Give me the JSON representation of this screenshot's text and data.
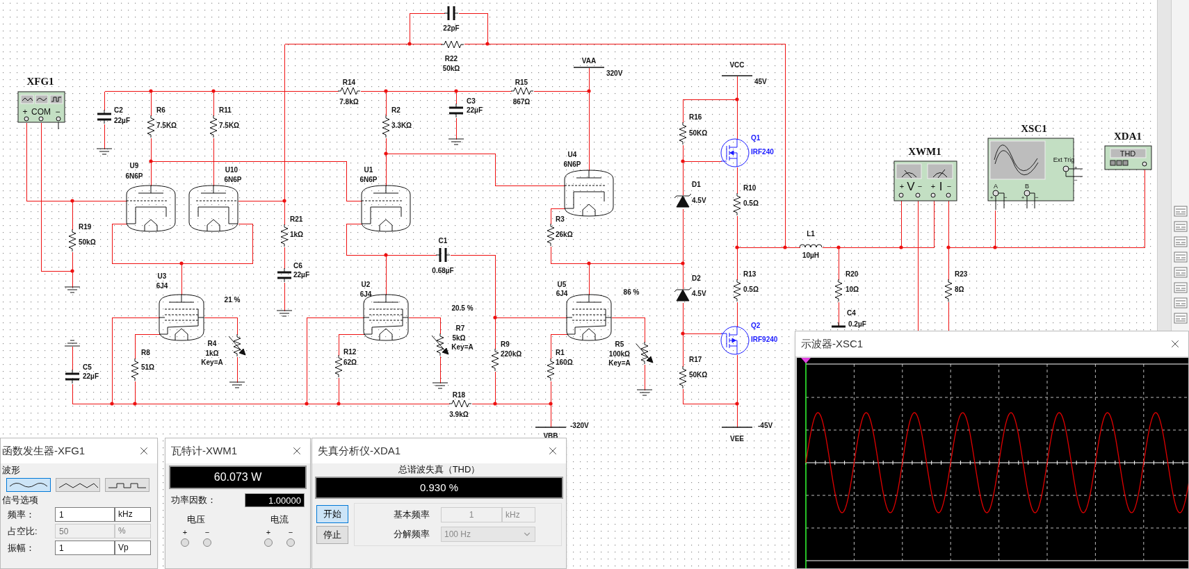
{
  "schematic": {
    "instruments": [
      {
        "kind": "function_generator",
        "label": "XFG1",
        "terminals": [
          "+",
          "COM",
          "−"
        ]
      },
      {
        "kind": "wattmeter",
        "label": "XWM1",
        "terminals": [
          "+",
          "V",
          "−",
          "+",
          "I",
          "−"
        ]
      },
      {
        "kind": "oscilloscope",
        "label": "XSC1",
        "trigger": "Ext Trig",
        "channels": [
          "A",
          "B"
        ],
        "signs": [
          "+",
          "−"
        ]
      },
      {
        "kind": "distortion_analyzer",
        "label": "XDA1",
        "display": "THD"
      }
    ],
    "parts": [
      {
        "kind": "capacitor",
        "ref": "C2",
        "value": "22µF"
      },
      {
        "kind": "resistor",
        "ref": "R6",
        "value": "7.5KΩ"
      },
      {
        "kind": "resistor",
        "ref": "R11",
        "value": "7.5KΩ"
      },
      {
        "kind": "resistor",
        "ref": "R14",
        "value": "7.8kΩ"
      },
      {
        "kind": "resistor",
        "ref": "R2",
        "value": "3.3KΩ"
      },
      {
        "kind": "triode",
        "ref": "U9",
        "value": "6N6P"
      },
      {
        "kind": "triode",
        "ref": "U10",
        "value": "6N6P"
      },
      {
        "kind": "triode",
        "ref": "U1",
        "value": "6N6P"
      },
      {
        "kind": "resistor",
        "ref": "R19",
        "value": "50kΩ"
      },
      {
        "kind": "resistor",
        "ref": "R21",
        "value": "1kΩ"
      },
      {
        "kind": "capacitor",
        "ref": "C6",
        "value": "22µF"
      },
      {
        "kind": "pentode",
        "ref": "U3",
        "value": "6J4"
      },
      {
        "kind": "potentiometer",
        "ref": "R4",
        "value": "1kΩ",
        "key": "Key=A",
        "setting": "21 %"
      },
      {
        "kind": "capacitor",
        "ref": "C5",
        "value": "22µF"
      },
      {
        "kind": "resistor",
        "ref": "R8",
        "value": "51Ω"
      },
      {
        "kind": "pentode",
        "ref": "U2",
        "value": "6J4"
      },
      {
        "kind": "resistor",
        "ref": "R12",
        "value": "62Ω"
      },
      {
        "kind": "capacitor",
        "value": "22pF"
      },
      {
        "kind": "resistor",
        "ref": "R22",
        "value": "50kΩ"
      },
      {
        "kind": "capacitor",
        "ref": "C3",
        "value": "22µF"
      },
      {
        "kind": "resistor",
        "ref": "R15",
        "value": "867Ω"
      },
      {
        "kind": "rail",
        "ref": "VAA",
        "value": "320V"
      },
      {
        "kind": "triode",
        "ref": "U4",
        "value": "6N6P"
      },
      {
        "kind": "resistor",
        "ref": "R3",
        "value": "26kΩ"
      },
      {
        "kind": "capacitor",
        "ref": "C1",
        "value": "0.68µF"
      },
      {
        "kind": "potentiometer",
        "ref": "R7",
        "value": "5kΩ",
        "key": "Key=A",
        "setting": "20.5 %"
      },
      {
        "kind": "resistor",
        "ref": "R9",
        "value": "220kΩ"
      },
      {
        "kind": "pentode",
        "ref": "U5",
        "value": "6J4"
      },
      {
        "kind": "resistor",
        "ref": "R1",
        "value": "160Ω"
      },
      {
        "kind": "potentiometer",
        "ref": "R5",
        "value": "100kΩ",
        "key": "Key=A",
        "setting": "86 %"
      },
      {
        "kind": "resistor",
        "ref": "R18",
        "value": "3.9kΩ"
      },
      {
        "kind": "rail",
        "ref": "VBB",
        "value": "-320V"
      },
      {
        "kind": "rail",
        "ref": "VCC",
        "value": "45V"
      },
      {
        "kind": "resistor",
        "ref": "R16",
        "value": "50KΩ"
      },
      {
        "kind": "nmos",
        "ref": "Q1",
        "value": "IRF240"
      },
      {
        "kind": "zener",
        "ref": "D1",
        "value": "4.5V"
      },
      {
        "kind": "resistor",
        "ref": "R10",
        "value": "0.5Ω"
      },
      {
        "kind": "inductor",
        "ref": "L1",
        "value": "10µH"
      },
      {
        "kind": "resistor",
        "ref": "R13",
        "value": "0.5Ω"
      },
      {
        "kind": "zener",
        "ref": "D2",
        "value": "4.5V"
      },
      {
        "kind": "pmos",
        "ref": "Q2",
        "value": "IRF9240"
      },
      {
        "kind": "resistor",
        "ref": "R17",
        "value": "50KΩ"
      },
      {
        "kind": "rail",
        "ref": "VEE",
        "value": "-45V"
      },
      {
        "kind": "resistor",
        "ref": "R20",
        "value": "10Ω"
      },
      {
        "kind": "capacitor",
        "ref": "C4",
        "value": "0.2µF"
      },
      {
        "kind": "resistor",
        "ref": "R23",
        "value": "8Ω"
      }
    ]
  },
  "windows": [
    {
      "kind": "function_generator",
      "title": "函数发生器-XFG1",
      "waveform_label": "波形",
      "waveforms": [
        {
          "kind": "sine",
          "selected": true
        },
        {
          "kind": "triangle",
          "selected": false
        },
        {
          "kind": "square",
          "selected": false
        }
      ],
      "options_label": "信号选项",
      "fields": [
        {
          "label": "频率：",
          "value": "1",
          "unit": "kHz",
          "disabled": false
        },
        {
          "label": "占空比:",
          "value": "50",
          "unit": "%",
          "disabled": true
        },
        {
          "label": "振幅：",
          "value": "1",
          "unit": "Vp",
          "disabled": false
        }
      ]
    },
    {
      "kind": "wattmeter",
      "title": "瓦特计-XWM1",
      "reading": "60.073 W",
      "power_factor_label": "功率因数：",
      "power_factor": "1.00000",
      "groups": [
        {
          "label": "电压",
          "terminals": [
            "+",
            "−"
          ]
        },
        {
          "label": "电流",
          "terminals": [
            "+",
            "−"
          ]
        }
      ]
    },
    {
      "kind": "distortion_analyzer",
      "title": "失真分析仪-XDA1",
      "measure_label": "总谐波失真（THD）",
      "reading": "0.930 %",
      "buttons": [
        {
          "label": "开始",
          "selected": true
        },
        {
          "label": "停止",
          "selected": false
        }
      ],
      "fields": [
        {
          "kind": "text",
          "label": "基本频率",
          "value": "1",
          "unit": "kHz",
          "disabled": true
        },
        {
          "kind": "select",
          "label": "分解频率",
          "value": "100 Hz",
          "disabled": true
        }
      ]
    },
    {
      "kind": "oscilloscope",
      "title": "示波器-XSC1"
    }
  ]
}
